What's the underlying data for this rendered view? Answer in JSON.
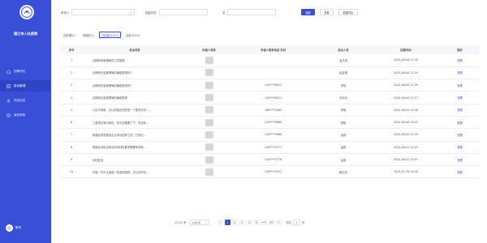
{
  "sidebar": {
    "org_name": "德江市人社资院",
    "items": [
      {
        "label": "招聘岗位",
        "icon": "home-icon",
        "active": false
      },
      {
        "label": "投诉管理",
        "icon": "document-icon",
        "active": true
      },
      {
        "label": "项目设定",
        "icon": "user-icon",
        "active": false
      },
      {
        "label": "我的审核",
        "icon": "check-icon",
        "active": false
      }
    ],
    "user_name": "账号"
  },
  "filters": {
    "applicant_label": "申请人",
    "applicant_placeholder": "",
    "proposer_label": "回复状态",
    "proposer_placeholder": "",
    "date_label": "至",
    "date_placeholder": ""
  },
  "buttons": {
    "search": "搜索",
    "reset": "重置",
    "export": "数据导出"
  },
  "tabs": [
    {
      "label": "待处理(2)",
      "active": false
    },
    {
      "label": "待回复(1)",
      "active": false
    },
    {
      "label": "已回复(2222)",
      "active": true
    },
    {
      "label": "全部(2223)",
      "active": false
    }
  ],
  "table": {
    "columns": [
      "序号",
      "投诉内容",
      "申请人电表",
      "申请人联系电话 手机",
      "投诉人员",
      "回复时间",
      "操作"
    ],
    "rows": [
      {
        "idx": "1",
        "title": "近期有用管理局的工作整理",
        "phone": "",
        "person": "孟凡卓",
        "time": "2024-08-06 17:30",
        "op": "查看"
      },
      {
        "idx": "2",
        "title": "近期有完善管理局的编制表现吗？",
        "phone": "",
        "person": "赵金展",
        "time": "2024-08-06 17:29",
        "op": "查看"
      },
      {
        "idx": "3",
        "title": "近期有完善管理局的编制表现吗？",
        "phone": "150****8011",
        "person": "郑晓",
        "time": "2024-08-06 17:29",
        "op": "查看"
      },
      {
        "idx": "4",
        "title": "近期有完善管理局的编制表现",
        "phone": "150****8011",
        "person": "马庆冰",
        "time": "2024-08-06 17:27",
        "op": "查看"
      },
      {
        "idx": "5",
        "title": "小区不收款，对以前固定的的是一个更多情况……",
        "phone": "188****5263",
        "person": "郑晓",
        "time": "2024-08-05 15:48",
        "op": "查看"
      },
      {
        "idx": "6",
        "title": "工程项目有时间的，有可否需要了下，有没有…",
        "phone": "125****8089",
        "person": "郑晓",
        "time": "2024-08-06 15:07",
        "op": "查看"
      },
      {
        "idx": "7",
        "title": "物建区享受建设企业申请结停了回，打他企…",
        "phone": "150****5869",
        "person": "孟霖",
        "time": "2024-08-05 15:29",
        "op": "查看"
      },
      {
        "idx": "8",
        "title": "物建区对相当申请申请材料要求需要来来新…",
        "phone": "150****9777",
        "person": "孟霖",
        "time": "2024-08-01 15:03",
        "op": "查看"
      },
      {
        "idx": "9",
        "title": "待回复信",
        "phone": "150****5776",
        "person": "孟霖",
        "time": "2024-08-01 15:07",
        "op": "查看"
      },
      {
        "idx": "10",
        "title": "不能一次不让我使一些费用相同，可以在申请…",
        "phone": "150****5251",
        "person": "蒋云杰",
        "time": "2024-07-26 15:48",
        "op": "查看"
      }
    ]
  },
  "pagination": {
    "total": "共 222 条",
    "page_size": "10条/页",
    "pages": [
      "1",
      "2",
      "3",
      "4",
      "5",
      "•••",
      "23"
    ],
    "current": "1",
    "goto_label": "前往",
    "goto_value": "1",
    "goto_unit": "页"
  },
  "colors": {
    "primary": "#3a4fd8",
    "sidebar_bg": "#3a4fd8"
  }
}
